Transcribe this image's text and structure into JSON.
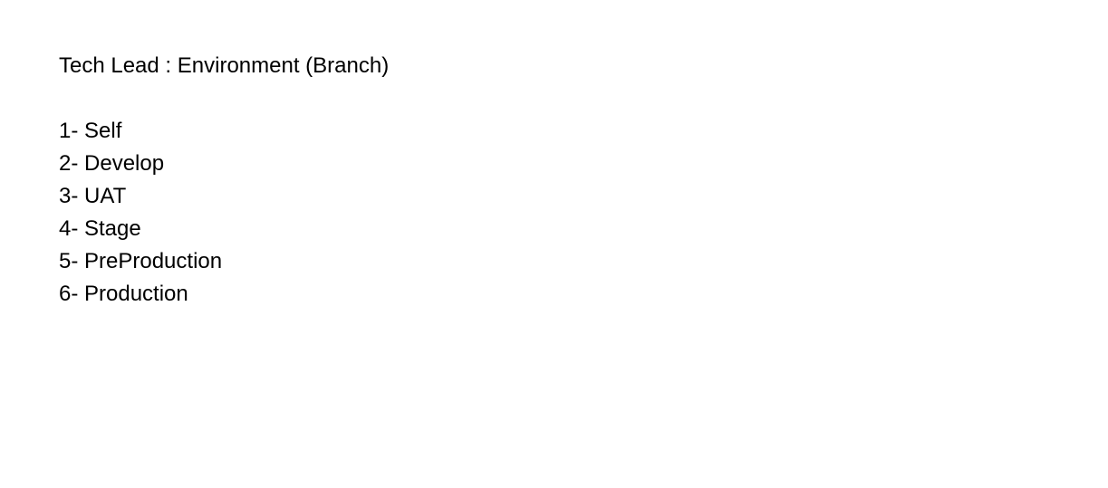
{
  "heading": "Tech Lead : Environment (Branch)",
  "environments": [
    "1- Self",
    "2- Develop",
    "3- UAT",
    "4- Stage",
    "5- PreProduction",
    "6- Production"
  ]
}
